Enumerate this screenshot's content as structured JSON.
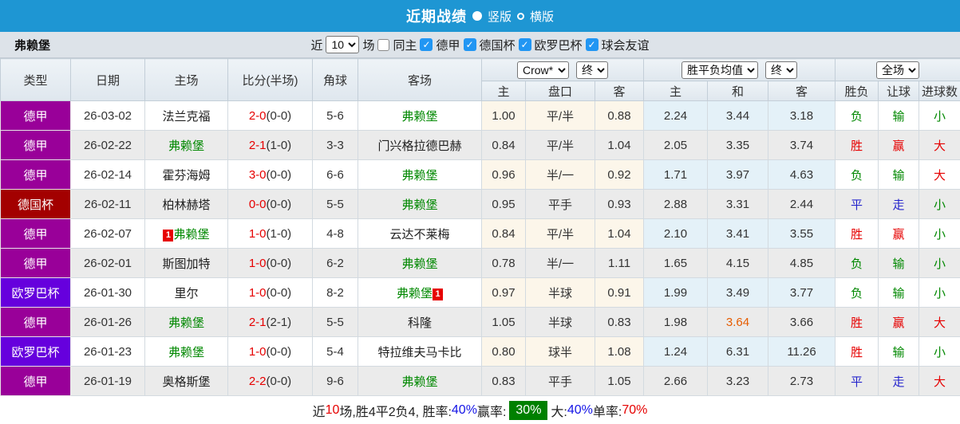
{
  "titlebar": {
    "title": "近期战绩",
    "layout_options": [
      {
        "label": "竖版",
        "selected": true
      },
      {
        "label": "横版",
        "selected": false
      }
    ]
  },
  "filterbar": {
    "team": "弗赖堡",
    "near_label": "近",
    "games_count": "10",
    "games_label": "场",
    "same_home": {
      "label": "同主",
      "checked": false
    },
    "league_filters": [
      {
        "label": "德甲",
        "checked": true
      },
      {
        "label": "德国杯",
        "checked": true
      },
      {
        "label": "欧罗巴杯",
        "checked": true
      },
      {
        "label": "球会友谊",
        "checked": true
      }
    ]
  },
  "table": {
    "headers": {
      "type": "类型",
      "date": "日期",
      "home": "主场",
      "score": "比分(半场)",
      "corner": "角球",
      "away": "客场",
      "odds_sub": [
        "主",
        "盘口",
        "客"
      ],
      "avg_sub": [
        "主",
        "和",
        "客"
      ],
      "result_sub": [
        "胜负",
        "让球",
        "进球数"
      ]
    },
    "selects": {
      "odds_source": "Crow*",
      "odds_state": "终",
      "avg_label": "胜平负均值",
      "avg_state": "终",
      "scope": "全场"
    },
    "league_colors": {
      "德甲": "#990099",
      "德国杯": "#a30000",
      "欧罗巴杯": "#6600dd"
    },
    "result_colors": {
      "r": "#e60000",
      "g": "#008800",
      "b": "#2525cc"
    },
    "score_color": "#e60000",
    "team_highlight_color": "#008800",
    "avg_highlight_color": "#e65c00",
    "rows": [
      {
        "league": "德甲",
        "date": "26-03-02",
        "home": "法兰克福",
        "home_is_team": false,
        "home_badge": "",
        "score_ft": "2-0",
        "score_ht": "(0-0)",
        "corner": "5-6",
        "away": "弗赖堡",
        "away_is_team": true,
        "away_badge": "",
        "odds": [
          "1.00",
          "平/半",
          "0.88"
        ],
        "avg": [
          "2.24",
          "3.44",
          "3.18"
        ],
        "avg_highlight": -1,
        "result": [
          [
            "负",
            "g"
          ],
          [
            "输",
            "g"
          ],
          [
            "小",
            "g"
          ]
        ]
      },
      {
        "league": "德甲",
        "date": "26-02-22",
        "home": "弗赖堡",
        "home_is_team": true,
        "home_badge": "",
        "score_ft": "2-1",
        "score_ht": "(1-0)",
        "corner": "3-3",
        "away": "门兴格拉德巴赫",
        "away_is_team": false,
        "away_badge": "",
        "odds": [
          "0.84",
          "平/半",
          "1.04"
        ],
        "avg": [
          "2.05",
          "3.35",
          "3.74"
        ],
        "avg_highlight": -1,
        "result": [
          [
            "胜",
            "r"
          ],
          [
            "赢",
            "r"
          ],
          [
            "大",
            "r"
          ]
        ]
      },
      {
        "league": "德甲",
        "date": "26-02-14",
        "home": "霍芬海姆",
        "home_is_team": false,
        "home_badge": "",
        "score_ft": "3-0",
        "score_ht": "(0-0)",
        "corner": "6-6",
        "away": "弗赖堡",
        "away_is_team": true,
        "away_badge": "",
        "odds": [
          "0.96",
          "半/一",
          "0.92"
        ],
        "avg": [
          "1.71",
          "3.97",
          "4.63"
        ],
        "avg_highlight": -1,
        "result": [
          [
            "负",
            "g"
          ],
          [
            "输",
            "g"
          ],
          [
            "大",
            "r"
          ]
        ]
      },
      {
        "league": "德国杯",
        "date": "26-02-11",
        "home": "柏林赫塔",
        "home_is_team": false,
        "home_badge": "",
        "score_ft": "0-0",
        "score_ht": "(0-0)",
        "corner": "5-5",
        "away": "弗赖堡",
        "away_is_team": true,
        "away_badge": "",
        "odds": [
          "0.95",
          "平手",
          "0.93"
        ],
        "avg": [
          "2.88",
          "3.31",
          "2.44"
        ],
        "avg_highlight": -1,
        "result": [
          [
            "平",
            "b"
          ],
          [
            "走",
            "b"
          ],
          [
            "小",
            "g"
          ]
        ]
      },
      {
        "league": "德甲",
        "date": "26-02-07",
        "home": "弗赖堡",
        "home_is_team": true,
        "home_badge": "1",
        "score_ft": "1-0",
        "score_ht": "(1-0)",
        "corner": "4-8",
        "away": "云达不莱梅",
        "away_is_team": false,
        "away_badge": "",
        "odds": [
          "0.84",
          "平/半",
          "1.04"
        ],
        "avg": [
          "2.10",
          "3.41",
          "3.55"
        ],
        "avg_highlight": -1,
        "result": [
          [
            "胜",
            "r"
          ],
          [
            "赢",
            "r"
          ],
          [
            "小",
            "g"
          ]
        ]
      },
      {
        "league": "德甲",
        "date": "26-02-01",
        "home": "斯图加特",
        "home_is_team": false,
        "home_badge": "",
        "score_ft": "1-0",
        "score_ht": "(0-0)",
        "corner": "6-2",
        "away": "弗赖堡",
        "away_is_team": true,
        "away_badge": "",
        "odds": [
          "0.78",
          "半/一",
          "1.11"
        ],
        "avg": [
          "1.65",
          "4.15",
          "4.85"
        ],
        "avg_highlight": -1,
        "result": [
          [
            "负",
            "g"
          ],
          [
            "输",
            "g"
          ],
          [
            "小",
            "g"
          ]
        ]
      },
      {
        "league": "欧罗巴杯",
        "date": "26-01-30",
        "home": "里尔",
        "home_is_team": false,
        "home_badge": "",
        "score_ft": "1-0",
        "score_ht": "(0-0)",
        "corner": "8-2",
        "away": "弗赖堡",
        "away_is_team": true,
        "away_badge": "1",
        "odds": [
          "0.97",
          "半球",
          "0.91"
        ],
        "avg": [
          "1.99",
          "3.49",
          "3.77"
        ],
        "avg_highlight": -1,
        "result": [
          [
            "负",
            "g"
          ],
          [
            "输",
            "g"
          ],
          [
            "小",
            "g"
          ]
        ]
      },
      {
        "league": "德甲",
        "date": "26-01-26",
        "home": "弗赖堡",
        "home_is_team": true,
        "home_badge": "",
        "score_ft": "2-1",
        "score_ht": "(2-1)",
        "corner": "5-5",
        "away": "科隆",
        "away_is_team": false,
        "away_badge": "",
        "odds": [
          "1.05",
          "半球",
          "0.83"
        ],
        "avg": [
          "1.98",
          "3.64",
          "3.66"
        ],
        "avg_highlight": 1,
        "result": [
          [
            "胜",
            "r"
          ],
          [
            "赢",
            "r"
          ],
          [
            "大",
            "r"
          ]
        ]
      },
      {
        "league": "欧罗巴杯",
        "date": "26-01-23",
        "home": "弗赖堡",
        "home_is_team": true,
        "home_badge": "",
        "score_ft": "1-0",
        "score_ht": "(0-0)",
        "corner": "5-4",
        "away": "特拉维夫马卡比",
        "away_is_team": false,
        "away_badge": "",
        "odds": [
          "0.80",
          "球半",
          "1.08"
        ],
        "avg": [
          "1.24",
          "6.31",
          "11.26"
        ],
        "avg_highlight": -1,
        "result": [
          [
            "胜",
            "r"
          ],
          [
            "输",
            "g"
          ],
          [
            "小",
            "g"
          ]
        ]
      },
      {
        "league": "德甲",
        "date": "26-01-19",
        "home": "奥格斯堡",
        "home_is_team": false,
        "home_badge": "",
        "score_ft": "2-2",
        "score_ht": "(0-0)",
        "corner": "9-6",
        "away": "弗赖堡",
        "away_is_team": true,
        "away_badge": "",
        "odds": [
          "0.83",
          "平手",
          "1.05"
        ],
        "avg": [
          "2.66",
          "3.23",
          "2.73"
        ],
        "avg_highlight": -1,
        "result": [
          [
            "平",
            "b"
          ],
          [
            "走",
            "b"
          ],
          [
            "大",
            "r"
          ]
        ]
      }
    ]
  },
  "footer": {
    "segments": [
      {
        "text": "近",
        "style": "plain"
      },
      {
        "text": "10",
        "style": "red"
      },
      {
        "text": "场,胜4平2负4, 胜率:",
        "style": "plain"
      },
      {
        "text": "40%",
        "style": "blue"
      },
      {
        "text": " 赢率:",
        "style": "plain"
      },
      {
        "text": "30%",
        "style": "greenbox"
      },
      {
        "text": " 大:",
        "style": "plain"
      },
      {
        "text": "40%",
        "style": "blue"
      },
      {
        "text": " 单率:",
        "style": "plain"
      },
      {
        "text": "70%",
        "style": "red"
      }
    ]
  }
}
